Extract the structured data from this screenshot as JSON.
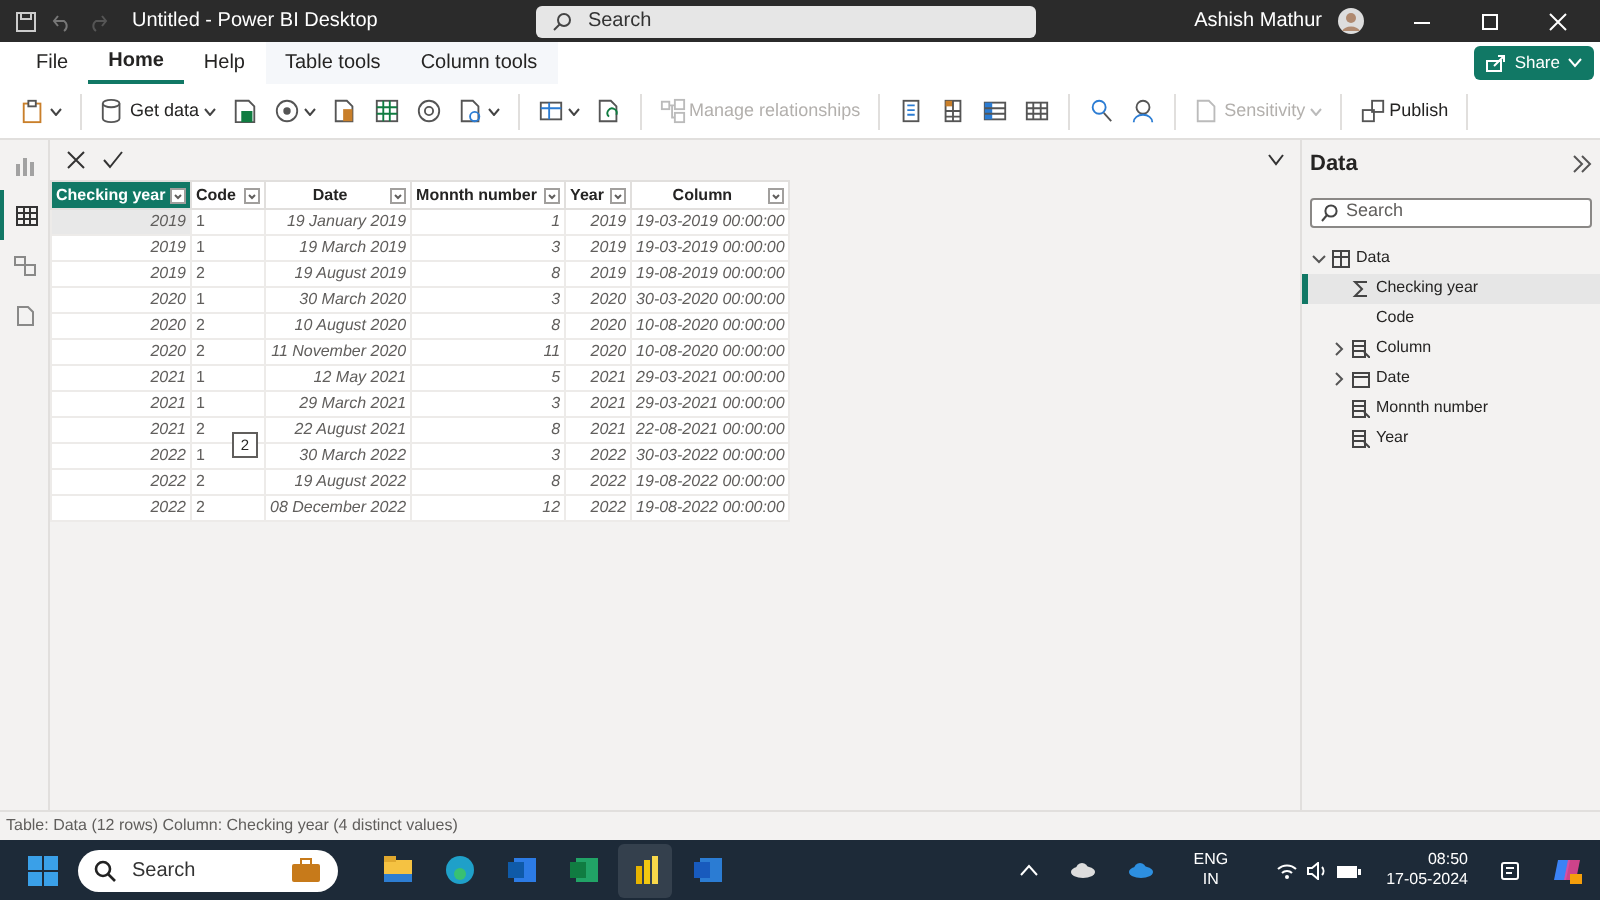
{
  "title_bar": {
    "title": "Untitled - Power BI Desktop",
    "search_placeholder": "Search",
    "user_name": "Ashish Mathur"
  },
  "ribbon_tabs": [
    {
      "label": "File",
      "selected": false,
      "kind": "normal"
    },
    {
      "label": "Home",
      "selected": true,
      "kind": "normal"
    },
    {
      "label": "Help",
      "selected": false,
      "kind": "normal"
    },
    {
      "label": "Table tools",
      "selected": false,
      "kind": "contextual"
    },
    {
      "label": "Column tools",
      "selected": false,
      "kind": "contextual"
    }
  ],
  "share_button": {
    "label": "Share"
  },
  "toolbar": [
    {
      "label": "Get data",
      "disabled": false
    },
    {
      "label": "Manage relationships",
      "disabled": true
    },
    {
      "label": "Sensitivity",
      "disabled": true
    },
    {
      "label": "Publish",
      "disabled": false
    }
  ],
  "views": [
    {
      "selected": false
    },
    {
      "selected": true
    },
    {
      "selected": false
    },
    {
      "selected": false
    }
  ],
  "table": {
    "columns": [
      {
        "label": "Checking year",
        "selected": true
      },
      {
        "label": "Code",
        "selected": false
      },
      {
        "label": "Date",
        "selected": false
      },
      {
        "label": "Monnth number",
        "selected": false
      },
      {
        "label": "Year",
        "selected": false
      },
      {
        "label": "Column",
        "selected": false
      }
    ],
    "rows": [
      [
        "2019",
        "1",
        "19 January 2019",
        "1",
        "2019",
        "19-03-2019 00:00:00"
      ],
      [
        "2019",
        "1",
        "19 March 2019",
        "3",
        "2019",
        "19-03-2019 00:00:00"
      ],
      [
        "2019",
        "2",
        "19 August 2019",
        "8",
        "2019",
        "19-08-2019 00:00:00"
      ],
      [
        "2020",
        "1",
        "30 March 2020",
        "3",
        "2020",
        "30-03-2020 00:00:00"
      ],
      [
        "2020",
        "2",
        "10 August 2020",
        "8",
        "2020",
        "10-08-2020 00:00:00"
      ],
      [
        "2020",
        "2",
        "11 November 2020",
        "11",
        "2020",
        "10-08-2020 00:00:00"
      ],
      [
        "2021",
        "1",
        "12 May 2021",
        "5",
        "2021",
        "29-03-2021 00:00:00"
      ],
      [
        "2021",
        "1",
        "29 March 2021",
        "3",
        "2021",
        "29-03-2021 00:00:00"
      ],
      [
        "2021",
        "2",
        "22 August 2021",
        "8",
        "2021",
        "22-08-2021 00:00:00"
      ],
      [
        "2022",
        "1",
        "30 March 2022",
        "3",
        "2022",
        "30-03-2022 00:00:00"
      ],
      [
        "2022",
        "2",
        "19 August 2022",
        "8",
        "2022",
        "19-08-2022 00:00:00"
      ],
      [
        "2022",
        "2",
        "08 December 2022",
        "12",
        "2022",
        "19-08-2022 00:00:00"
      ]
    ],
    "cell_tooltip": "2"
  },
  "data_panel": {
    "title": "Data",
    "search_placeholder": "Search",
    "tree": [
      {
        "label": "Data",
        "kind": "table",
        "expanded": true,
        "children": [
          {
            "label": "Checking year",
            "kind": "sum",
            "selected": true
          },
          {
            "label": "Code",
            "kind": "plain",
            "selected": false
          },
          {
            "label": "Column",
            "kind": "calc",
            "expanded": false,
            "selected": false
          },
          {
            "label": "Date",
            "kind": "date",
            "expanded": false,
            "selected": false
          },
          {
            "label": "Monnth number",
            "kind": "calc",
            "selected": false
          },
          {
            "label": "Year",
            "kind": "calc",
            "selected": false
          }
        ]
      }
    ]
  },
  "status_bar": "Table: Data (12 rows) Column: Checking year (4 distinct values)",
  "taskbar": {
    "search_placeholder": "Search",
    "language": "ENG",
    "region": "IN",
    "time": "08:50",
    "date": "17-05-2024"
  }
}
